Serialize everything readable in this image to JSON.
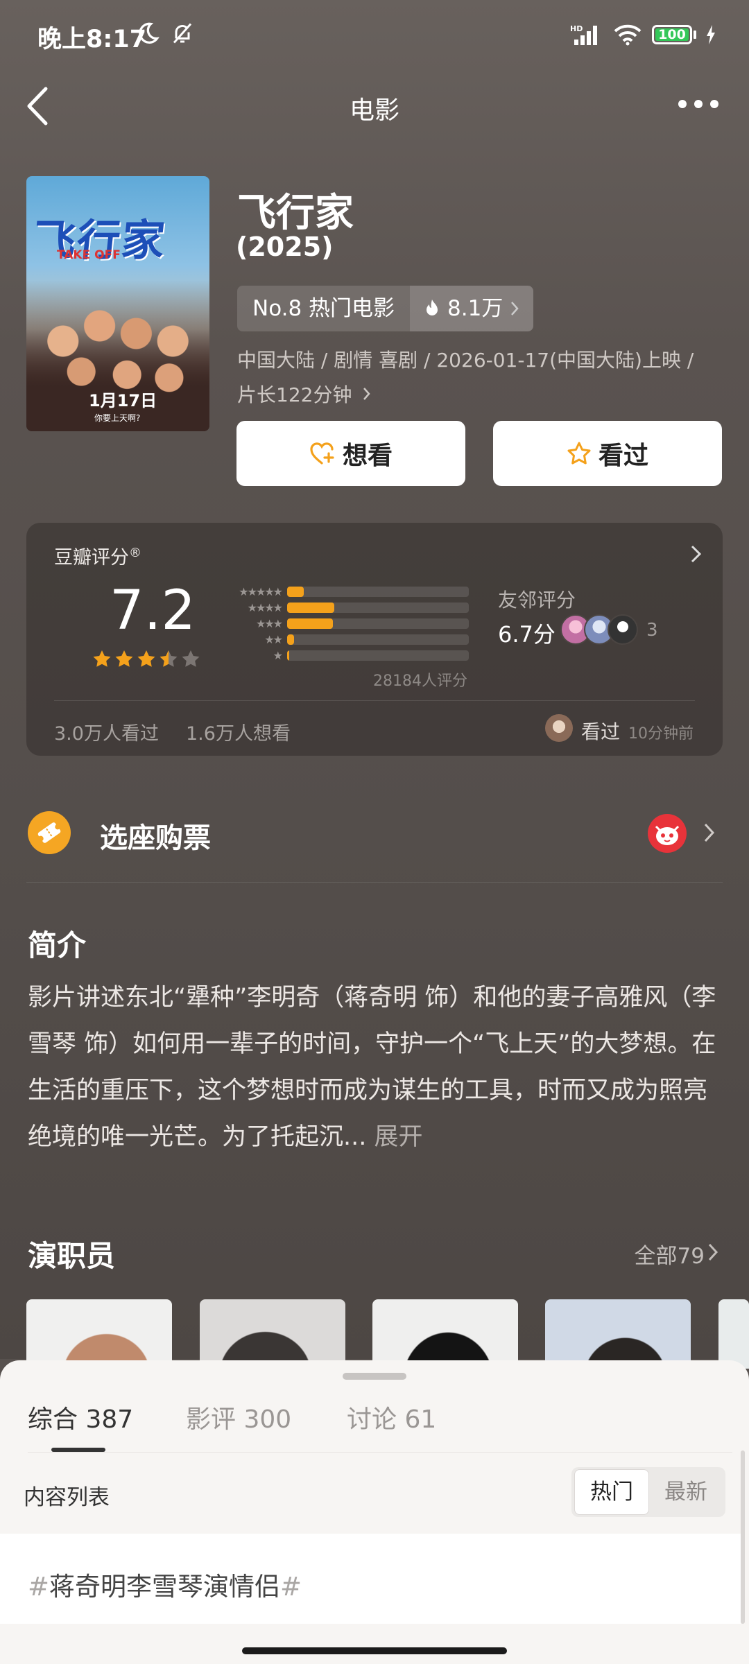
{
  "status_bar": {
    "time": "晚上8:17",
    "battery": "100",
    "signal": "HD"
  },
  "nav": {
    "title": "电影"
  },
  "movie": {
    "poster_title": "飞行家",
    "poster_sub": "TAKE OFF",
    "poster_date": "1月17日",
    "poster_tag": "你要上天啊?",
    "title": "飞行家",
    "year": "(2025)",
    "rank_label": "No.8 热门电影",
    "heat": "8.1万",
    "meta_line1": "中国大陆 / 剧情 喜剧 / 2026-01-17(中国大陆)上映 /",
    "meta_line2": "片长122分钟"
  },
  "actions": {
    "want": "想看",
    "seen": "看过"
  },
  "rating": {
    "label": "豆瓣评分",
    "score": "7.2",
    "stars_value": 3.5,
    "distribution": [
      {
        "stars": "★★★★★",
        "fraction": 0.09
      },
      {
        "stars": "★★★★",
        "fraction": 0.26
      },
      {
        "stars": "★★★",
        "fraction": 0.25
      },
      {
        "stars": "★★",
        "fraction": 0.04
      },
      {
        "stars": "★",
        "fraction": 0.01
      }
    ],
    "count_text": "28184人评分",
    "friends_label": "友邻评分",
    "friends_score": "6.7分",
    "friends_count": "3",
    "seen_count": "3.0万人看过",
    "want_count": "1.6万人想看",
    "user_action": "看过",
    "user_time": "10分钟前"
  },
  "ticket": {
    "label": "选座购票"
  },
  "intro": {
    "title": "简介",
    "text": "影片讲述东北“犟种”李明奇（蒋奇明 饰）和他的妻子高雅风（李雪琴 饰）如何用一辈子的时间，守护一个“飞上天”的大梦想。在生活的重压下，这个梦想时而成为谋生的工具，时而又成为照亮绝境的唯一光芒。为了托起沉...",
    "expand": "展开"
  },
  "cast": {
    "title": "演职员",
    "all_label": "全部79"
  },
  "sheet": {
    "tabs": [
      {
        "label": "综合 387"
      },
      {
        "label": "影评 300"
      },
      {
        "label": "讨论 61"
      }
    ],
    "list_label": "内容列表",
    "sort_hot": "热门",
    "sort_new": "最新",
    "topic": "蒋奇明李雪琴演情侣",
    "hash": "#"
  },
  "colors": {
    "accent": "#f4a11b",
    "background": "#57514e",
    "sheet": "#f7f5f3"
  }
}
